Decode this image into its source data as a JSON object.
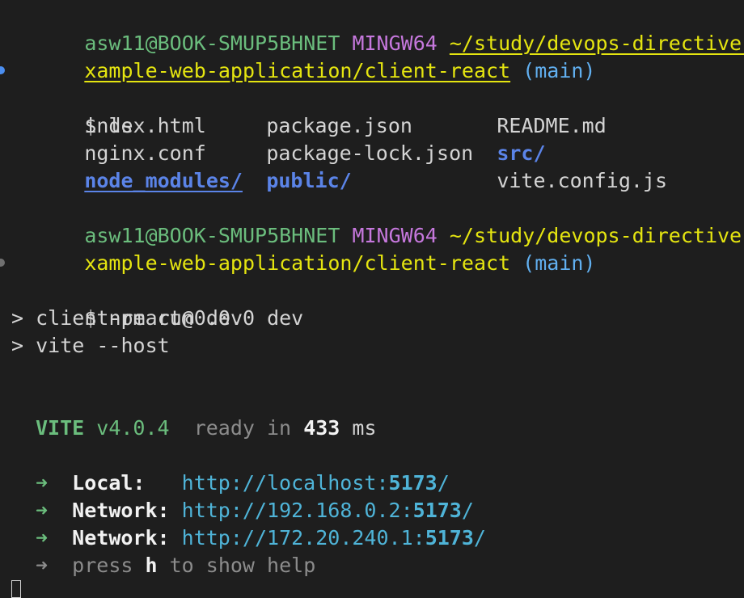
{
  "terminal": {
    "prompt1": {
      "user_host": "asw11@BOOK-SMUP5BHNET",
      "system": "MINGW64",
      "path_line1": "~/study/devops-directive-docker",
      "path_line2": "xample-web-application/client-react",
      "branch": "(main)"
    },
    "cmd1": {
      "symbol": "$",
      "text": "ls"
    },
    "ls_output": [
      [
        "index.html",
        "package.json",
        "README.md"
      ],
      [
        "nginx.conf",
        "package-lock.json",
        "src/"
      ],
      [
        "node_modules/",
        "public/",
        "vite.config.js"
      ]
    ],
    "prompt2": {
      "user_host": "asw11@BOOK-SMUP5BHNET",
      "system": "MINGW64",
      "path_line1": "~/study/devops-directive-docker",
      "path_line2": "xample-web-application/client-react",
      "branch": "(main)"
    },
    "cmd2": {
      "symbol": "$",
      "text": "npm run dev"
    },
    "npm_output": {
      "line1": "> client-react@0.0.0 dev",
      "line2": "> vite --host"
    },
    "vite": {
      "name": "VITE",
      "version": "v4.0.4",
      "ready_prefix": "ready in",
      "ready_ms": "433",
      "ms_unit": "ms",
      "arrow": "➜",
      "local_label": "Local:",
      "local_url_prefix": "http://localhost:",
      "local_port": "5173",
      "local_url_suffix": "/",
      "network_label": "Network:",
      "network1_url_prefix": "http://192.168.0.2:",
      "network1_port": "5173",
      "network1_url_suffix": "/",
      "network2_url_prefix": "http://172.20.240.1:",
      "network2_port": "5173",
      "network2_url_suffix": "/",
      "help_press": "press",
      "help_key": "h",
      "help_rest": "to show help"
    },
    "colors": {
      "background": "#1e1e1e",
      "user_host": "#6bbd7d",
      "system": "#c678dd",
      "path": "#e5e510",
      "branch": "#61afef",
      "directory": "#5b84e8",
      "url": "#4fb4d8",
      "prompt_marker_success": "#4b8ef0",
      "prompt_marker_pending": "#707070"
    }
  }
}
